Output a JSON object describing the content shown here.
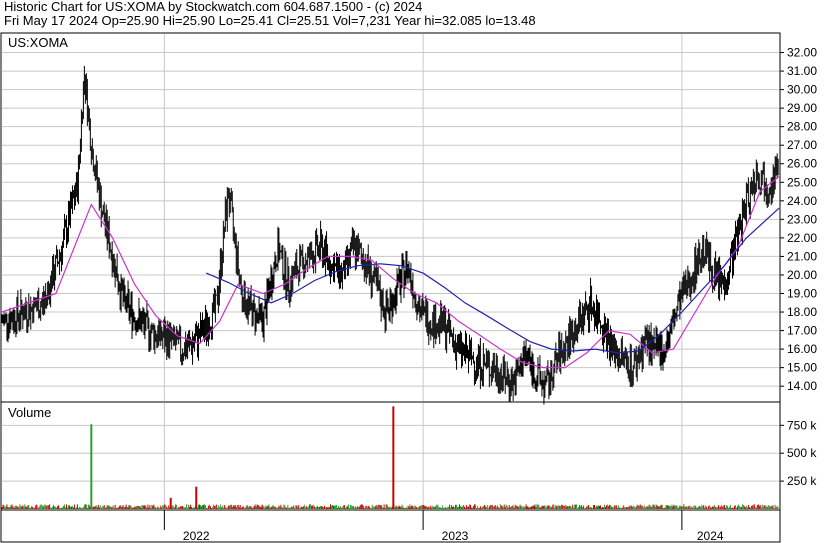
{
  "header": {
    "line1": "Historic Chart for US:XOMA by Stockwatch.com 604.687.1500 - (c) 2024",
    "line2": "Fri May 17 2024  Op=25.90  Hi=25.90  Lo=25.41  Cl=25.51  Vol=7,231  Year hi=32.085  lo=13.48"
  },
  "price_panel": {
    "symbol_label": "US:XOMA"
  },
  "volume_panel": {
    "label": "Volume"
  },
  "colors": {
    "price_bars": "#000000",
    "ma_short": "#cc33cc",
    "ma_long": "#2222aa",
    "vol_up": "#2ca02c",
    "vol_down": "#cc0000",
    "grid": "#c8c8c8"
  },
  "chart_data": [
    {
      "type": "line",
      "title": "",
      "ylabel": "",
      "ylim": [
        13.2,
        33.0
      ],
      "y_ticks": [
        14,
        15,
        16,
        17,
        18,
        19,
        20,
        21,
        22,
        23,
        24,
        25,
        26,
        27,
        28,
        29,
        30,
        31,
        32
      ],
      "y_tick_labels": [
        "14.00",
        "15.00",
        "16.00",
        "17.00",
        "18.00",
        "19.00",
        "20.00",
        "21.00",
        "22.00",
        "23.00",
        "24.00",
        "25.00",
        "26.00",
        "27.00",
        "28.00",
        "29.00",
        "30.00",
        "31.00",
        "32.00"
      ],
      "x_labels": [
        "2022",
        "2023",
        "2024"
      ],
      "x_label_dates": [
        "2022-01-01",
        "2023-01-01",
        "2024-01-01"
      ],
      "x_range": [
        "2021-05-17",
        "2024-05-17"
      ],
      "series": [
        {
          "style": "ohlc-bars",
          "x": [
            "2021-05-17",
            "2021-06-15",
            "2021-07-15",
            "2021-08-10",
            "2021-09-01",
            "2021-09-10",
            "2021-09-20",
            "2021-10-05",
            "2021-10-20",
            "2021-11-05",
            "2021-11-20",
            "2021-12-05",
            "2021-12-20",
            "2022-01-10",
            "2022-01-25",
            "2022-02-10",
            "2022-02-25",
            "2022-03-15",
            "2022-04-01",
            "2022-04-20",
            "2022-05-05",
            "2022-05-20",
            "2022-06-10",
            "2022-06-25",
            "2022-07-10",
            "2022-07-25",
            "2022-08-10",
            "2022-08-25",
            "2022-09-10",
            "2022-09-25",
            "2022-10-10",
            "2022-10-25",
            "2022-11-10",
            "2022-11-25",
            "2022-12-10",
            "2022-12-28",
            "2023-01-15",
            "2023-02-01",
            "2023-02-20",
            "2023-03-10",
            "2023-03-25",
            "2023-04-10",
            "2023-04-25",
            "2023-05-10",
            "2023-05-25",
            "2023-06-10",
            "2023-06-25",
            "2023-07-10",
            "2023-07-25",
            "2023-08-10",
            "2023-08-25",
            "2023-09-10",
            "2023-09-25",
            "2023-10-10",
            "2023-10-25",
            "2023-11-10",
            "2023-11-25",
            "2023-12-10",
            "2023-12-28",
            "2024-01-15",
            "2024-02-01",
            "2024-02-15",
            "2024-03-01",
            "2024-03-15",
            "2024-04-01",
            "2024-04-15",
            "2024-05-01",
            "2024-05-17"
          ],
          "values": [
            17.5,
            18.0,
            18.5,
            21.5,
            25.0,
            31.0,
            27.0,
            23.5,
            21.0,
            18.5,
            17.8,
            17.2,
            16.8,
            16.5,
            16.0,
            16.3,
            17.0,
            18.2,
            24.5,
            19.0,
            18.0,
            17.5,
            21.5,
            19.5,
            20.5,
            21.0,
            21.5,
            20.5,
            20.0,
            21.5,
            20.8,
            19.5,
            18.0,
            19.2,
            20.5,
            18.0,
            17.5,
            17.2,
            16.0,
            15.5,
            15.2,
            15.0,
            14.5,
            14.2,
            15.8,
            14.5,
            14.0,
            15.5,
            16.5,
            17.5,
            18.5,
            17.5,
            16.0,
            15.5,
            15.0,
            16.5,
            15.8,
            16.2,
            18.5,
            20.0,
            21.5,
            20.0,
            19.5,
            21.5,
            24.0,
            25.5,
            25.0,
            25.51
          ]
        },
        {
          "name": "",
          "style": "moving-average-short",
          "x": [
            "2021-05-17",
            "2021-08-01",
            "2021-09-20",
            "2021-10-20",
            "2021-11-20",
            "2021-12-20",
            "2022-01-20",
            "2022-02-20",
            "2022-03-20",
            "2022-04-15",
            "2022-05-20",
            "2022-06-20",
            "2022-07-20",
            "2022-08-20",
            "2022-09-20",
            "2022-10-20",
            "2022-11-20",
            "2022-12-20",
            "2023-01-20",
            "2023-02-20",
            "2023-03-20",
            "2023-04-20",
            "2023-05-20",
            "2023-06-20",
            "2023-07-20",
            "2023-08-20",
            "2023-09-20",
            "2023-10-20",
            "2023-11-20",
            "2023-12-20",
            "2024-01-20",
            "2024-02-20",
            "2024-03-20",
            "2024-04-20",
            "2024-05-17"
          ],
          "values": [
            18.0,
            19.0,
            23.8,
            22.0,
            19.5,
            17.8,
            16.7,
            16.3,
            17.5,
            19.5,
            19.0,
            19.5,
            20.3,
            21.0,
            21.0,
            20.8,
            19.8,
            19.0,
            18.5,
            17.5,
            16.8,
            16.0,
            15.3,
            15.0,
            15.0,
            15.8,
            17.0,
            16.8,
            15.8,
            16.0,
            18.0,
            20.0,
            21.5,
            24.5,
            25.3
          ]
        },
        {
          "name": "",
          "style": "moving-average-long",
          "x": [
            "2022-03-01",
            "2022-04-01",
            "2022-05-01",
            "2022-06-01",
            "2022-07-01",
            "2022-08-01",
            "2022-09-01",
            "2022-10-01",
            "2022-11-01",
            "2022-12-01",
            "2023-01-01",
            "2023-02-01",
            "2023-03-01",
            "2023-04-01",
            "2023-05-01",
            "2023-06-01",
            "2023-07-01",
            "2023-08-01",
            "2023-09-01",
            "2023-10-01",
            "2023-11-01",
            "2023-12-01",
            "2024-01-01",
            "2024-02-01",
            "2024-03-01",
            "2024-04-01",
            "2024-05-17"
          ],
          "values": [
            20.1,
            19.6,
            19.0,
            18.5,
            19.0,
            19.7,
            20.2,
            20.5,
            20.6,
            20.5,
            20.1,
            19.3,
            18.5,
            17.8,
            17.1,
            16.4,
            16.0,
            15.9,
            16.0,
            15.8,
            15.9,
            16.8,
            18.0,
            19.3,
            20.5,
            22.0,
            23.6
          ]
        }
      ]
    },
    {
      "type": "bar",
      "title": "",
      "ylabel": "",
      "ylim": [
        0,
        950000
      ],
      "y_ticks": [
        250000,
        500000,
        750000
      ],
      "y_tick_labels": [
        "250 k",
        "500 k",
        "750 k"
      ],
      "spikes": [
        {
          "date": "2021-09-20",
          "value": 760000,
          "direction": "up"
        },
        {
          "date": "2022-02-15",
          "value": 200000,
          "direction": "down"
        },
        {
          "date": "2022-01-10",
          "value": 100000,
          "direction": "down"
        },
        {
          "date": "2022-11-20",
          "value": 920000,
          "direction": "down"
        }
      ],
      "typical_value": 25000
    }
  ]
}
